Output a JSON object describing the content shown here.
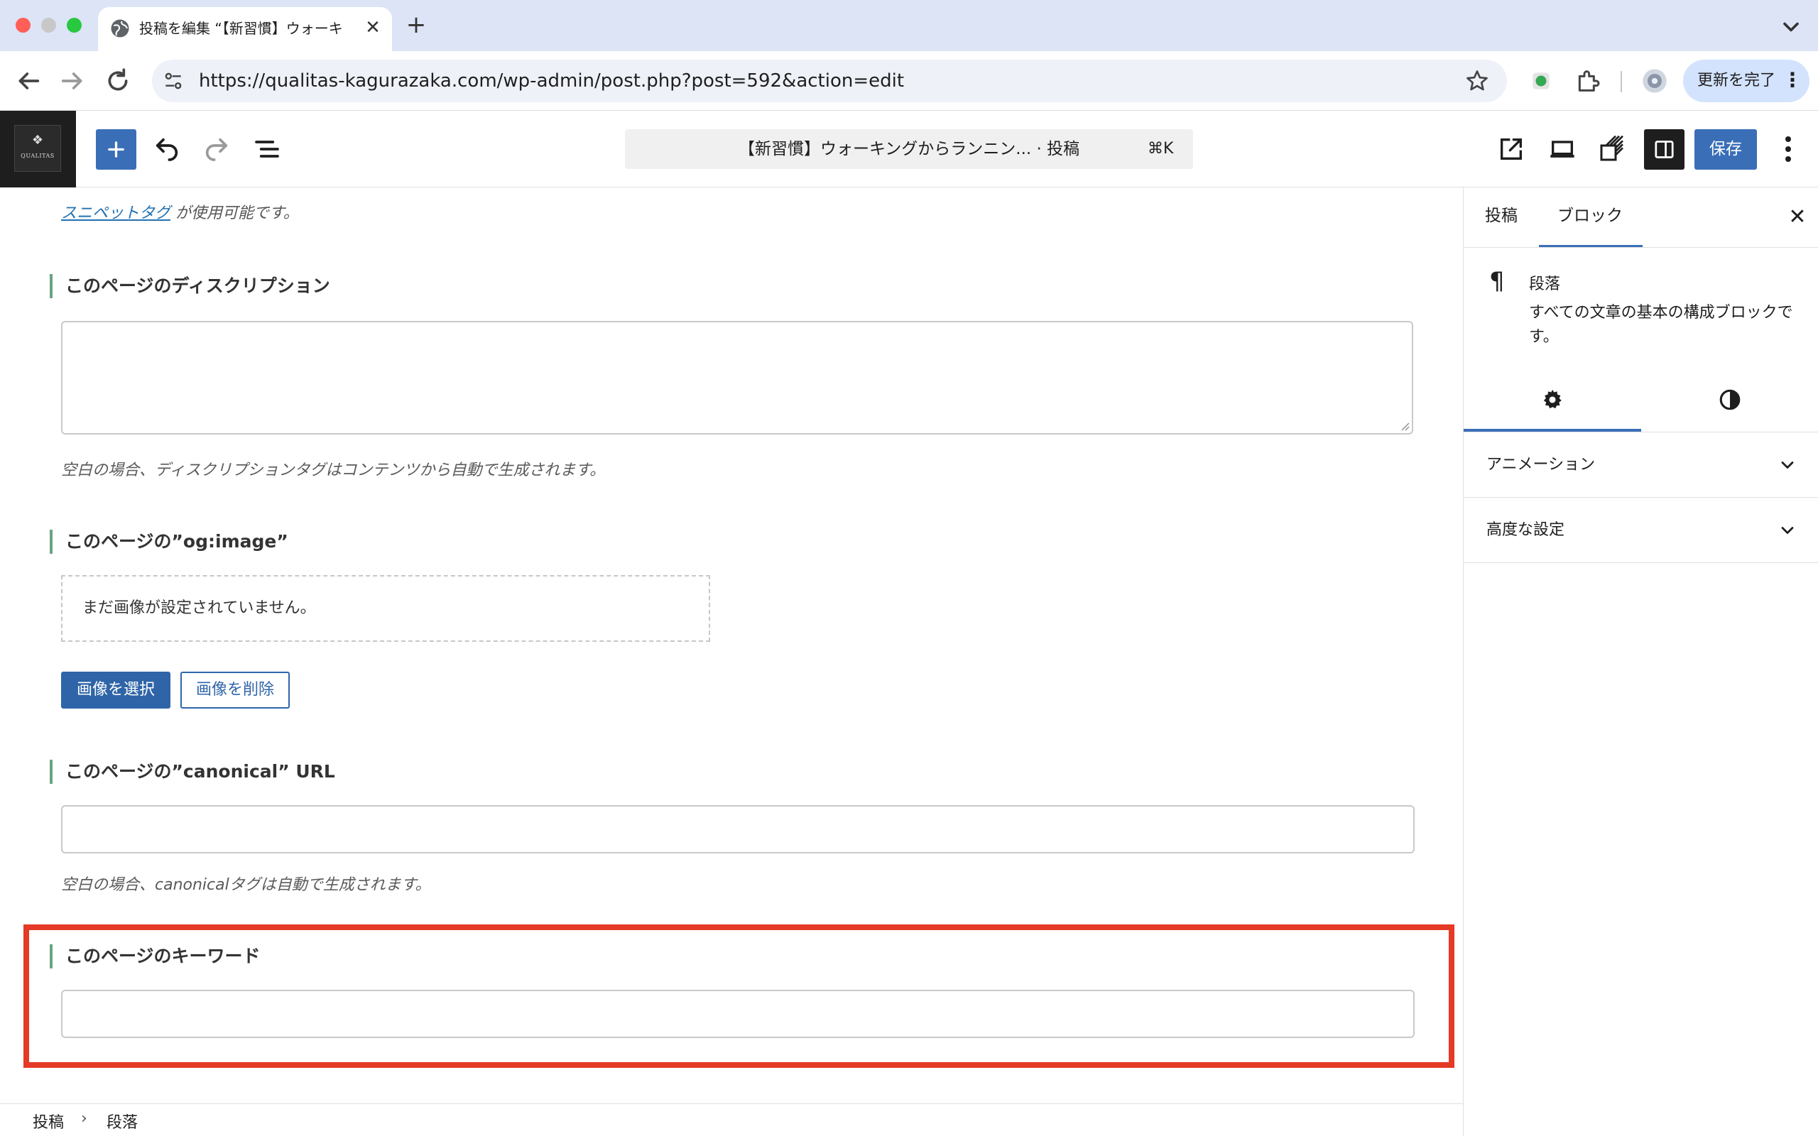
{
  "browser": {
    "tab_title": "投稿を編集 “【新習慣】ウォーキ",
    "tab_close": "✕",
    "new_tab": "+",
    "url": "https://qualitas-kagurazaka.com/wp-admin/post.php?post=592&action=edit",
    "update_label": "更新を完了",
    "update_menu": "⋮",
    "colors": {
      "close": "#ff5f57",
      "minimize": "#c8c8c8",
      "maximize": "#28c840",
      "tabbar": "#dce4f6"
    }
  },
  "editor": {
    "logo_text": "QUALITAS",
    "logo_mark": "❖",
    "command_title": "【新習慣】ウォーキングからランニン... · 投稿",
    "command_shortcut": "⌘K",
    "save_label": "保存",
    "accent": "#3a6fb8"
  },
  "content": {
    "snippet_link": "スニペットタグ",
    "snippet_rest": " が使用可能です。",
    "description_title": "このページのディスクリプション",
    "description_value": "",
    "description_hint": "空白の場合、ディスクリプションタグはコンテンツから自動で生成されます。",
    "og_title": "このページの”og:image”",
    "og_empty": "まだ画像が設定されていません。",
    "select_image": "画像を選択",
    "remove_image": "画像を削除",
    "canonical_title": "このページの”canonical” URL",
    "canonical_value": "",
    "canonical_hint": "空白の場合、canonicalタグは自動で生成されます。",
    "keyword_title": "このページのキーワード",
    "keyword_value": "",
    "highlight_color": "#e53a25"
  },
  "breadcrumb": {
    "item1": "投稿",
    "sep": "›",
    "item2": "段落"
  },
  "sidebar": {
    "tab_post": "投稿",
    "tab_block": "ブロック",
    "close": "✕",
    "block_icon": "¶",
    "block_name": "段落",
    "block_description": "すべての文章の基本の構成ブロックです。",
    "panel_animation": "アニメーション",
    "panel_advanced": "高度な設定"
  }
}
